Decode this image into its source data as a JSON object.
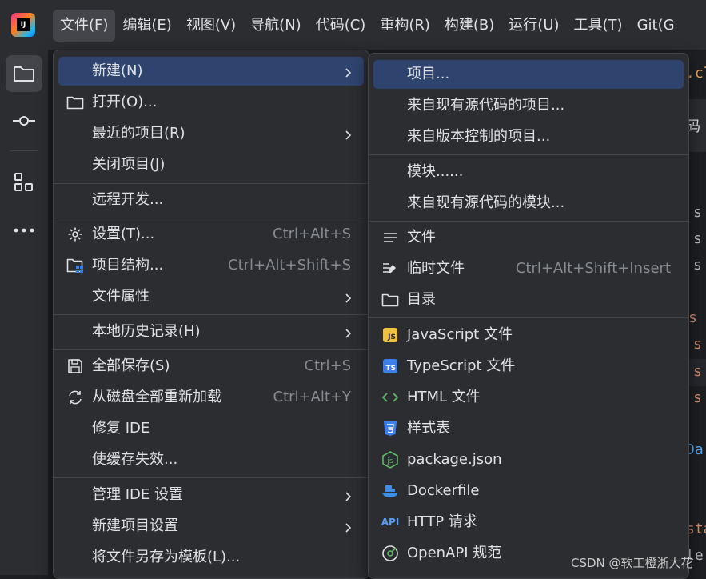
{
  "app": {
    "logo_text": "IJ",
    "logo_label": "intellij-idea-logo"
  },
  "menubar": [
    "文件(F)",
    "编辑(E)",
    "视图(V)",
    "导航(N)",
    "代码(C)",
    "重构(R)",
    "构建(B)",
    "运行(U)",
    "工具(T)",
    "Git(G"
  ],
  "editor_fragments": [
    ".cla",
    "码",
    "s",
    "s",
    "s",
    "s",
    "s",
    "s",
    "s",
    "Da",
    "sta",
    "le"
  ],
  "file_menu": {
    "items": [
      {
        "label": "新建(N)",
        "shortcut": "",
        "submenu": true,
        "icon": ""
      },
      {
        "label": "打开(O)...",
        "shortcut": "",
        "submenu": false,
        "icon": "folder-icon"
      },
      {
        "label": "最近的项目(R)",
        "shortcut": "",
        "submenu": true,
        "icon": ""
      },
      {
        "label": "关闭项目(J)",
        "shortcut": "",
        "submenu": false,
        "icon": ""
      },
      {
        "label": "远程开发...",
        "shortcut": "",
        "submenu": false,
        "icon": ""
      },
      {
        "label": "设置(T)...",
        "shortcut": "Ctrl+Alt+S",
        "submenu": false,
        "icon": "gear-icon"
      },
      {
        "label": "项目结构...",
        "shortcut": "Ctrl+Alt+Shift+S",
        "submenu": false,
        "icon": "project-structure-icon"
      },
      {
        "label": "文件属性",
        "shortcut": "",
        "submenu": true,
        "icon": ""
      },
      {
        "label": "本地历史记录(H)",
        "shortcut": "",
        "submenu": true,
        "icon": ""
      },
      {
        "label": "全部保存(S)",
        "shortcut": "Ctrl+S",
        "submenu": false,
        "icon": "save-icon"
      },
      {
        "label": "从磁盘全部重新加载",
        "shortcut": "Ctrl+Alt+Y",
        "submenu": false,
        "icon": "reload-icon"
      },
      {
        "label": "修复 IDE",
        "shortcut": "",
        "submenu": false,
        "icon": ""
      },
      {
        "label": "使缓存失效...",
        "shortcut": "",
        "submenu": false,
        "icon": ""
      },
      {
        "label": "管理 IDE 设置",
        "shortcut": "",
        "submenu": true,
        "icon": ""
      },
      {
        "label": "新建项目设置",
        "shortcut": "",
        "submenu": true,
        "icon": ""
      },
      {
        "label": "将文件另存为模板(L)...",
        "shortcut": "",
        "submenu": false,
        "icon": ""
      }
    ]
  },
  "new_submenu": {
    "items": [
      {
        "label": "项目...",
        "shortcut": "",
        "icon": ""
      },
      {
        "label": "来自现有源代码的项目...",
        "shortcut": "",
        "icon": ""
      },
      {
        "label": "来自版本控制的项目...",
        "shortcut": "",
        "icon": ""
      },
      {
        "label": "模块......",
        "shortcut": "",
        "icon": ""
      },
      {
        "label": "来自现有源代码的模块...",
        "shortcut": "",
        "icon": ""
      },
      {
        "label": "文件",
        "shortcut": "",
        "icon": "file-icon"
      },
      {
        "label": "临时文件",
        "shortcut": "Ctrl+Alt+Shift+Insert",
        "icon": "scratch-file-icon"
      },
      {
        "label": "目录",
        "shortcut": "",
        "icon": "folder-icon"
      },
      {
        "label": "JavaScript 文件",
        "shortcut": "",
        "icon": "javascript-icon",
        "badge": "JS"
      },
      {
        "label": "TypeScript 文件",
        "shortcut": "",
        "icon": "typescript-icon",
        "badge": "TS"
      },
      {
        "label": "HTML 文件",
        "shortcut": "",
        "icon": "html-icon"
      },
      {
        "label": "样式表",
        "shortcut": "",
        "icon": "css-icon"
      },
      {
        "label": "package.json",
        "shortcut": "",
        "icon": "nodejs-icon"
      },
      {
        "label": "Dockerfile",
        "shortcut": "",
        "icon": "docker-icon"
      },
      {
        "label": "HTTP 请求",
        "shortcut": "",
        "icon": "http-api-icon",
        "badge": "API"
      },
      {
        "label": "OpenAPI 规范",
        "shortcut": "",
        "icon": "openapi-icon"
      }
    ]
  },
  "watermark": "CSDN @软工橙浙大花",
  "colors": {
    "accent_selection": "#2e436e",
    "popup_bg": "#2b2d30",
    "js_badge": "#f0c040",
    "ts_badge": "#3d7ee8"
  }
}
